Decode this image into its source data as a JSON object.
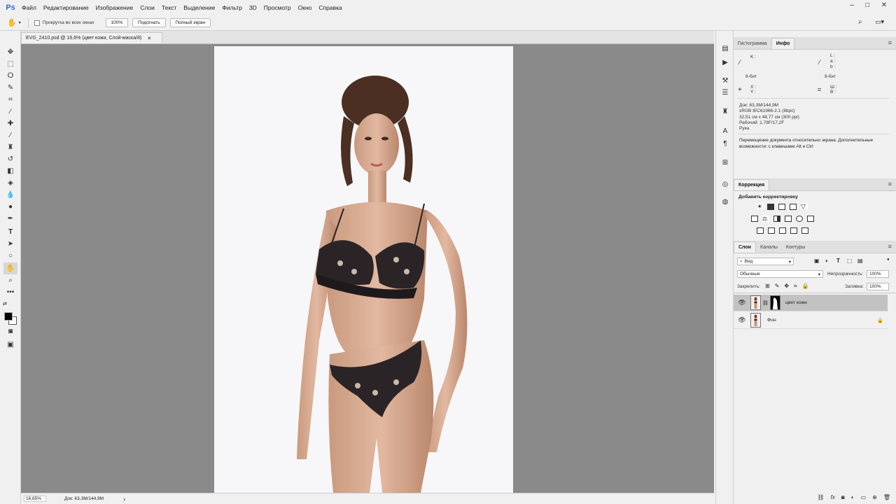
{
  "app": {
    "logo": "Ps"
  },
  "menu": [
    "Файл",
    "Редактирование",
    "Изображение",
    "Слои",
    "Текст",
    "Выделение",
    "Фильтр",
    "3D",
    "Просмотр",
    "Окно",
    "Справка"
  ],
  "window_controls": {
    "minimize": "–",
    "maximize": "□",
    "close": "✕"
  },
  "options": {
    "scroll_all_label": "Прокрутка во всех окнах",
    "btn_100": "100%",
    "btn_fit": "Подогнать",
    "btn_fullscreen": "Полный экран"
  },
  "document": {
    "tab_title": "EVG_2410.psd @ 16,6% (цвет кожи, Слой-маска/8)",
    "tab_close": "✕"
  },
  "status": {
    "zoom": "16,65%",
    "doc": "Док: 63,3M/144,9M",
    "arrow": "›"
  },
  "info_panel": {
    "tabs": [
      "Гистограмма",
      "Инфо"
    ],
    "active_tab": "Инфо",
    "k_label": "K :",
    "bit_left": "8-бит",
    "lab": [
      "L :",
      "a :",
      "b :"
    ],
    "bit_right": "8-бит",
    "x_label": "X :",
    "y_label": "Y :",
    "w_label": "Ш :",
    "h_label": "В :",
    "doc_info": [
      "Док: 63,3M/144,9M",
      "sRGB IEC61966-2.1 (8bpc)",
      "32,51 см x 48,77 см (300 ppi)",
      "Рабочий: 1,78F/17,2F",
      "Рука"
    ],
    "hint": "Перемещение документа относительно экрана. Дополнительные возможности: с клавишами Alt и Ctrl"
  },
  "adjustments": {
    "tab": "Коррекция",
    "add_label": "Добавить корректировку"
  },
  "layers_panel": {
    "tabs": [
      "Слои",
      "Каналы",
      "Контуры"
    ],
    "filter_value": "Вид",
    "blend_mode": "Обычные",
    "opacity_label": "Непрозрачность:",
    "opacity_value": "100%",
    "lock_label": "Закрепить:",
    "fill_label": "Заливка:",
    "fill_value": "100%",
    "layers": [
      {
        "name": "цвет кожи",
        "selected": true,
        "has_mask": true,
        "locked": false
      },
      {
        "name": "Фон",
        "selected": false,
        "has_mask": false,
        "locked": true
      }
    ],
    "bottom_icons": [
      "link-icon",
      "fx-icon",
      "mask-icon",
      "adjustment-icon",
      "folder-icon",
      "new-layer-icon",
      "trash-icon"
    ]
  }
}
